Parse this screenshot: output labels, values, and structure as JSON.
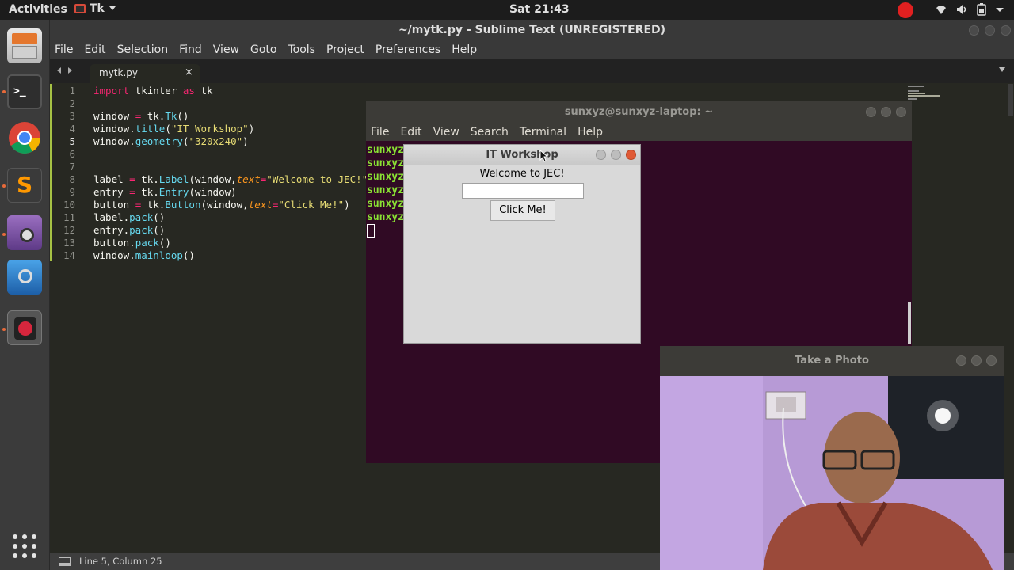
{
  "topbar": {
    "activities": "Activities",
    "app_menu": "Tk",
    "clock": "Sat 21:43"
  },
  "dock": {
    "items": [
      "terminal-icon",
      "chrome-icon",
      "sublime-icon",
      "webcam-icon",
      "vlc-icon",
      "screen-recorder-icon"
    ],
    "apps_grid": "show-applications-icon"
  },
  "sublime": {
    "title": "~/mytk.py - Sublime Text (UNREGISTERED)",
    "menu": [
      "File",
      "Edit",
      "Selection",
      "Find",
      "View",
      "Goto",
      "Tools",
      "Project",
      "Preferences",
      "Help"
    ],
    "tab": {
      "name": "mytk.py",
      "close": "×"
    },
    "status": "Line 5, Column 25"
  },
  "code": {
    "lines": [
      {
        "n": "1",
        "text": "import tkinter as tk"
      },
      {
        "n": "2",
        "text": ""
      },
      {
        "n": "3",
        "text": "window = tk.Tk()"
      },
      {
        "n": "4",
        "text": "window.title(\"IT Workshop\")"
      },
      {
        "n": "5",
        "text": "window.geometry(\"320x240\")"
      },
      {
        "n": "6",
        "text": ""
      },
      {
        "n": "7",
        "text": ""
      },
      {
        "n": "8",
        "text": "label = tk.Label(window,text=\"Welcome to JEC!\")"
      },
      {
        "n": "9",
        "text": "entry = tk.Entry(window)"
      },
      {
        "n": "10",
        "text": "button = tk.Button(window,text=\"Click Me!\")"
      },
      {
        "n": "11",
        "text": "label.pack()"
      },
      {
        "n": "12",
        "text": "entry.pack()"
      },
      {
        "n": "13",
        "text": "button.pack()"
      },
      {
        "n": "14",
        "text": "window.mainloop()"
      }
    ],
    "current_line": 5
  },
  "terminal": {
    "title": "sunxyz@sunxyz-laptop: ~",
    "menu": [
      "File",
      "Edit",
      "View",
      "Search",
      "Terminal",
      "Help"
    ],
    "lines": [
      "sunxyz",
      "sunxyz",
      "sunxyz",
      "sunxyz",
      "sunxyz",
      "sunxyz"
    ]
  },
  "tk_window": {
    "title": "IT Workshop",
    "label": "Welcome to JEC!",
    "entry_value": "",
    "button": "Click Me!"
  },
  "webcam": {
    "title": "Take a Photo"
  },
  "colors": {
    "editor_bg": "#272822",
    "terminal_bg": "#300a24",
    "prompt_green": "#8ae234",
    "keyword": "#f92672",
    "string": "#e6db74",
    "function": "#66d9ef"
  }
}
